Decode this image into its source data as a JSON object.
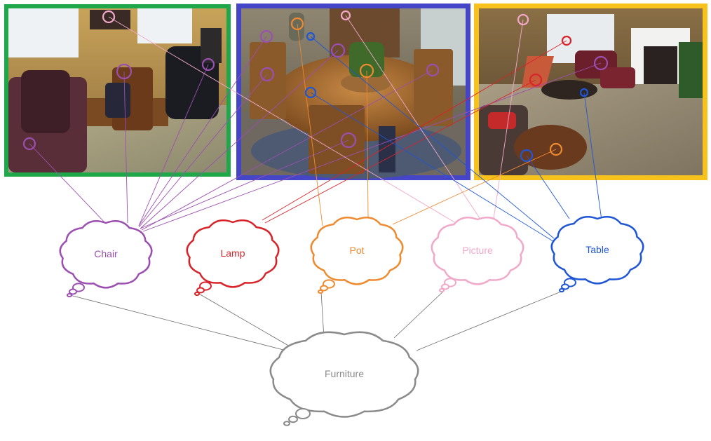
{
  "colors": {
    "chair": "#9b4fb0",
    "lamp": "#d8232a",
    "pot": "#ee8a2f",
    "picture": "#f2a9c9",
    "table": "#1f56d6",
    "furniture": "#8a8a8a",
    "frame_1": "#1fa84a",
    "frame_2": "#4545c8",
    "frame_3": "#f6c21b"
  },
  "photos": [
    {
      "name": "living-room-photo",
      "description_icon": "room-photo-icon"
    },
    {
      "name": "dining-room-photo",
      "description_icon": "room-photo-icon"
    },
    {
      "name": "family-room-photo",
      "description_icon": "room-photo-icon"
    }
  ],
  "clouds": {
    "chair": "Chair",
    "lamp": "Lamp",
    "pot": "Pot",
    "picture": "Picture",
    "table": "Table",
    "furniture": "Furniture"
  }
}
